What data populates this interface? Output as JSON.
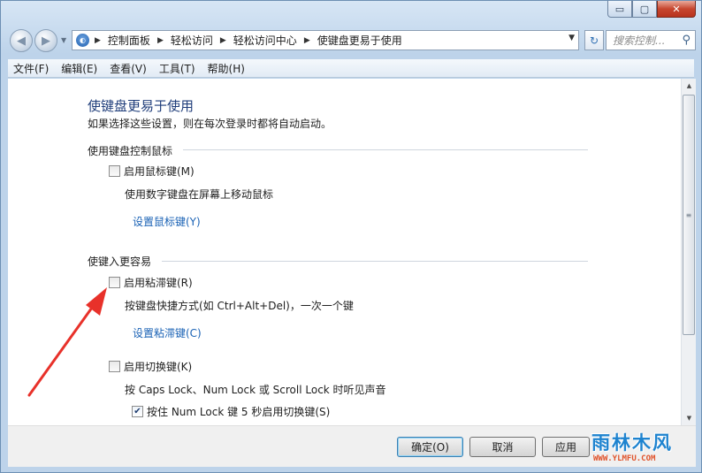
{
  "window": {
    "controls": {
      "minimize": "▭",
      "maximize": "▢",
      "close": "✕"
    }
  },
  "nav": {
    "back_glyph": "◀",
    "forward_glyph": "▶",
    "breadcrumbs": [
      "控制面板",
      "轻松访问",
      "轻松访问中心",
      "使键盘更易于使用"
    ],
    "search_placeholder": "搜索控制...",
    "address_icon": "control-panel-icon",
    "search_icon": "search-icon"
  },
  "menubar": {
    "items": [
      "文件(F)",
      "编辑(E)",
      "查看(V)",
      "工具(T)",
      "帮助(H)"
    ]
  },
  "content": {
    "title": "使键盘更易于使用",
    "subtitle": "如果选择这些设置，则在每次登录时都将自动启动。",
    "section1": {
      "heading": "使用键盘控制鼠标",
      "checkbox_label": "启用鼠标键(M)",
      "checked": false,
      "description": "使用数字键盘在屏幕上移动鼠标",
      "link": "设置鼠标键(Y)"
    },
    "section2": {
      "heading": "使键入更容易",
      "sticky": {
        "checkbox_label": "启用粘滞键(R)",
        "checked": false,
        "description": "按键盘快捷方式(如 Ctrl+Alt+Del)，一次一个键",
        "link": "设置粘滞键(C)"
      },
      "toggle": {
        "checkbox_label": "启用切换键(K)",
        "checked": false,
        "description": "按 Caps Lock、Num Lock 或 Scroll Lock 时听见声音",
        "sub_checkbox_label": "按住 Num Lock 键 5 秒启用切换键(S)",
        "sub_checked": true
      }
    }
  },
  "buttons": {
    "ok": "确定(O)",
    "cancel": "取消",
    "apply": "应用"
  },
  "watermark": {
    "top": "雨林木风",
    "bottom": "WWW.YLMFU.COM"
  },
  "colors": {
    "title_blue": "#1f3d7a",
    "link_blue": "#1a62b5",
    "arrow_red": "#e8312a"
  }
}
